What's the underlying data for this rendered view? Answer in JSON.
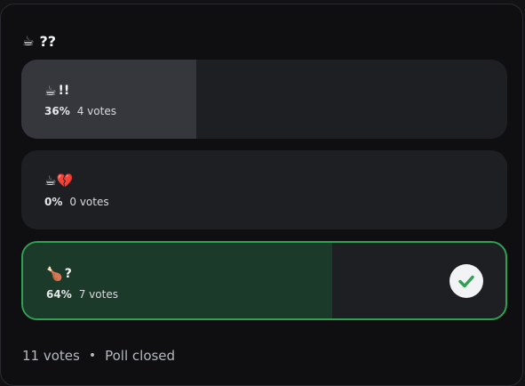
{
  "poll": {
    "question_emoji": "☕",
    "question_text": "??",
    "options": [
      {
        "emoji": "☕",
        "label": "!!",
        "percent": "36%",
        "votes": "4 votes",
        "fill_fraction": 0.36,
        "winner": false
      },
      {
        "emoji": "☕💔",
        "label": "",
        "percent": "0%",
        "votes": "0 votes",
        "fill_fraction": 0.0,
        "winner": false
      },
      {
        "emoji": "🍗",
        "label": "?",
        "percent": "64%",
        "votes": "7 votes",
        "fill_fraction": 0.64,
        "winner": true
      }
    ],
    "footer": {
      "total_votes": "11 votes",
      "separator": "•",
      "status": "Poll closed"
    }
  },
  "colors": {
    "winner_border": "#2fa152",
    "winner_fill": "#1c3a29",
    "check_icon": "#2fa152"
  },
  "icons": {
    "winner_check": "check-circle-icon"
  }
}
